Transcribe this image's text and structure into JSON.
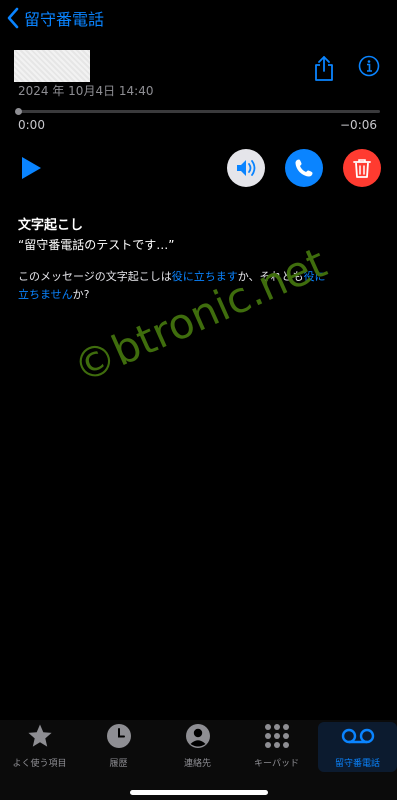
{
  "header": {
    "back_label": "留守番電話"
  },
  "voicemail": {
    "datetime": "2024 年 10月4日 14:40",
    "elapsed": "0:00",
    "remaining": "−0:06",
    "progress": 0.0
  },
  "transcript": {
    "title": "文字起こし",
    "quote": "“留守番電話のテストです…”",
    "feedback_prefix": "このメッセージの文字起こしは",
    "feedback_yes": "役に立ちます",
    "feedback_mid": "か、それとも",
    "feedback_no_1": "役に",
    "feedback_no_2": "立ちません",
    "feedback_suffix": "か?"
  },
  "watermark": "©btronic.net",
  "tabs": [
    {
      "label": "よく使う項目",
      "icon": "star-icon"
    },
    {
      "label": "履歴",
      "icon": "clock-icon"
    },
    {
      "label": "連絡先",
      "icon": "person-circle-icon"
    },
    {
      "label": "キーパッド",
      "icon": "keypad-icon"
    },
    {
      "label": "留守番電話",
      "icon": "voicemail-icon"
    }
  ],
  "colors": {
    "accent": "#0a84ff",
    "delete": "#ff3b30",
    "watermark": "#3f6d0d"
  }
}
